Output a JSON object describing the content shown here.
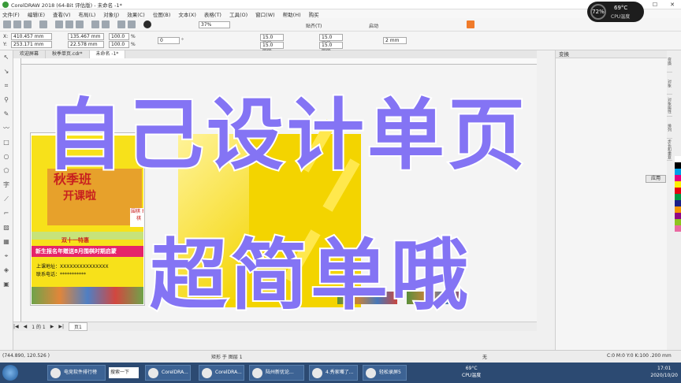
{
  "window": {
    "title": "CorelDRAW 2018 (64-Bit 评估版) - 未命名 -1*"
  },
  "menu": [
    "文件(F)",
    "编辑(E)",
    "查看(V)",
    "布局(L)",
    "对象(J)",
    "效果(C)",
    "位图(B)",
    "文本(X)",
    "表格(T)",
    "工具(O)",
    "窗口(W)",
    "帮助(H)",
    "购买"
  ],
  "toolbar": {
    "zoom": "37%",
    "snap": "贴齐(T)",
    "launch": "启动",
    "x": "410.457 mm",
    "y": "253.171 mm",
    "w": "135.467 mm",
    "h": "22.578 mm",
    "scale_w": "100.0",
    "scale_h": "100.0",
    "pct": "%",
    "angle": "0",
    "angle_unit": "°",
    "pos1": "15.0 mm",
    "pos2": "15.0 mm",
    "pos3": "15.0 mm",
    "pos4": "15.0 mm",
    "outline": "2 mm",
    "x_label": "X:",
    "y_label": "Y:"
  },
  "tabs": [
    "欢迎屏幕",
    "秋季单页.cdr*",
    "未命名 -1*"
  ],
  "headline": {
    "line1": "自己设计单页",
    "line2": "超简单哦"
  },
  "flyer": {
    "title1": "秋季班",
    "title2": "开课啦",
    "badge": "围棋 象棋",
    "promo": "双十一特惠",
    "banner": "新生报名年赠送8月围棋时期启蒙",
    "line1": "上课地址：XXXXXXXXXXXXXXX",
    "line2": "联系电话：***********"
  },
  "pages": {
    "label": "1 的 1",
    "tab": "页1"
  },
  "docker": {
    "title": "变换",
    "apply": "应用",
    "tabs": [
      "变换",
      "对象",
      "对象属性",
      "排列",
      "步长和重复"
    ]
  },
  "status": {
    "coords": "(744.890, 120.526 )",
    "desc": "矩形 于 图层 1",
    "color": "C:0 M:0 Y:0 K:100 .200 mm",
    "fill_label": "无"
  },
  "taskbar": {
    "search": "搜索一下",
    "items": [
      "电竞软件排行榜",
      "CorelDRA...",
      "CorelDRA...",
      "陆州新优论...",
      "4.秀家嘴了...",
      "轻松录屏5"
    ],
    "time": "17:01",
    "date": "2020/10/20",
    "temp": "69°C",
    "cpu_label": "CPU温度"
  },
  "cpu_widget": {
    "percent": "72%",
    "temp": "69°C",
    "label": "CPU温度"
  },
  "colors": {
    "headline": "#8474f4",
    "flyer_yellow": "#f7e11a",
    "page_yellow": "#f3d400",
    "taskbar": "#2c4a72"
  }
}
